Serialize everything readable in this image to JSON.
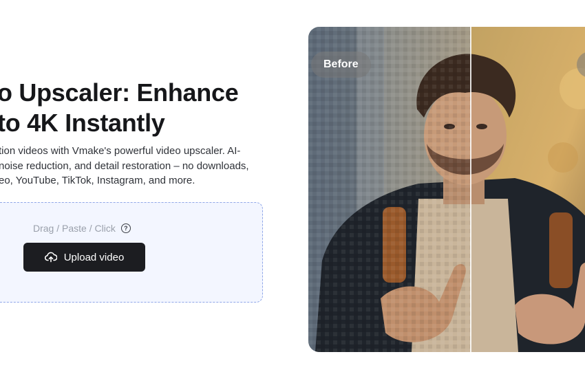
{
  "hero": {
    "title_line1": "o Upscaler: Enhance",
    "title_line2": "to 4K Instantly",
    "desc_line1": "tion videos with Vmake's powerful video upscaler. AI-",
    "desc_line2": "noise reduction, and detail restoration – no downloads,",
    "desc_line3": "eo, YouTube, TikTok, Instagram, and more."
  },
  "upload": {
    "hint": "Drag / Paste / Click",
    "help_glyph": "?",
    "button_label": "Upload video",
    "button_icon": "cloud-upload-icon"
  },
  "comparison": {
    "before_label": "Before",
    "after_label": ""
  },
  "colors": {
    "button_bg": "#1c1d21",
    "dropzone_bg": "#f3f6ff",
    "dropzone_border": "#8fa6e8"
  }
}
